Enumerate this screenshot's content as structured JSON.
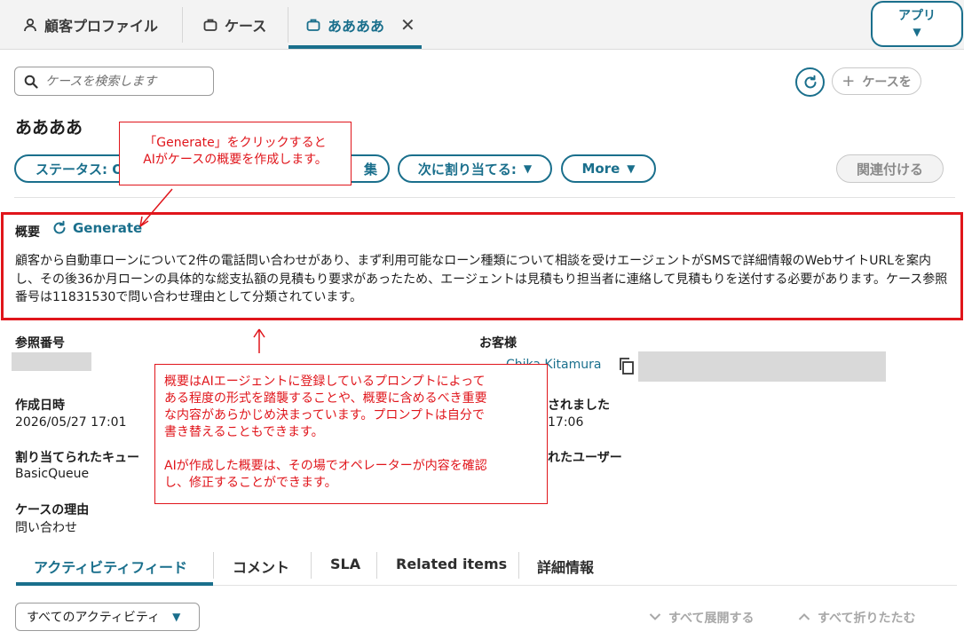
{
  "top_tabs": [
    {
      "label": "顧客プロファイル",
      "icon": "person-icon"
    },
    {
      "label": "ケース",
      "icon": "briefcase-icon"
    },
    {
      "label": "ああああ",
      "icon": "briefcase-icon",
      "active": true
    }
  ],
  "app_button": {
    "label": "アプリ",
    "caret": "▼"
  },
  "search": {
    "placeholder": "ケースを検索します"
  },
  "add_case_button": {
    "label": "ケースを"
  },
  "case_title": "ああああ",
  "actions": {
    "status": "ステータス: O",
    "edit": "集",
    "assign": "次に割り当てる:",
    "more": "More",
    "relate": "関連付ける"
  },
  "summary": {
    "label": "概要",
    "generate": "Generate",
    "text": "顧客から自動車ローンについて2件の電話問い合わせがあり、まず利用可能なローン種類について相談を受けエージェントがSMSで詳細情報のWebサイトURLを案内し、その後36か月ローンの具体的な総支払額の見積もり要求があったため、エージェントは見積もり担当者に連絡して見積もりを送付する必要があります。ケース参照番号は11831530で問い合わせ理由として分類されています。"
  },
  "fields": {
    "ref_label": "参照番号",
    "customer_label": "お客様",
    "customer_name": "Chika Kitamura",
    "created_label": "作成日時",
    "created_value": "2026/05/27 17:01",
    "updated_label_partial": "されました",
    "updated_value_partial": "17:06",
    "queue_label": "割り当てられたキュー",
    "queue_value": "BasicQueue",
    "user_label_partial": "れたユーザー",
    "reason_label": "ケースの理由",
    "reason_value": "問い合わせ"
  },
  "bottom_tabs": [
    "アクティビティフィード",
    "コメント",
    "SLA",
    "Related items",
    "詳細情報"
  ],
  "activity_filter": {
    "label": "すべてのアクティビティ",
    "caret": "▼"
  },
  "expand_all": "すべて展開する",
  "collapse_all": "すべて折りたたむ",
  "callouts": {
    "generate_note": [
      "「Generate」をクリックすると",
      "AIがケースの概要を作成します。"
    ],
    "summary_note": [
      "概要はAIエージェントに登録しているプロンプトによって",
      "ある程度の形式を踏襲することや、概要に含めるべき重要",
      "な内容があらかじめ決まっています。プロンプトは自分で",
      "書き替えることもできます。",
      "",
      "AIが作成した概要は、その場でオペレーターが内容を確認",
      "し、修正することができます。"
    ]
  },
  "colors": {
    "accent": "#1a6f8c",
    "annotation": "#e0151b",
    "disabled": "#8a8a8a",
    "redaction": "#d9d9d9"
  }
}
